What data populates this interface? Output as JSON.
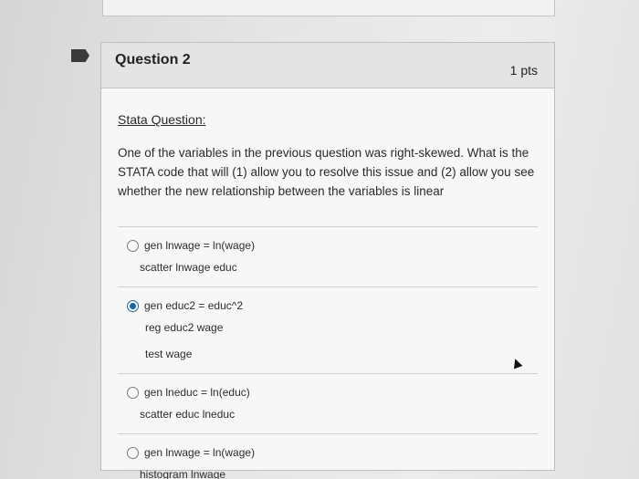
{
  "question": {
    "title": "Question 2",
    "points": "1 pts",
    "section_label": "Stata Question:",
    "prompt": "One of the variables in the previous question was right-skewed. What is the STATA code that will (1) allow you to resolve this issue and (2) allow you see whether the new relationship between the variables is linear"
  },
  "answers": [
    {
      "lines": [
        "gen lnwage = ln(wage)",
        "scatter lnwage educ"
      ],
      "selected": false
    },
    {
      "lines": [
        "gen educ2 = educ^2",
        "reg educ2 wage",
        "test wage"
      ],
      "selected": true
    },
    {
      "lines": [
        "gen lneduc = ln(educ)",
        "scatter educ lneduc"
      ],
      "selected": false
    },
    {
      "lines": [
        "gen lnwage = ln(wage)",
        "histogram lnwage"
      ],
      "selected": false
    }
  ],
  "colors": {
    "accent": "#1466a8",
    "header_bg": "#e4e4e4"
  },
  "icons": {
    "flag": "bookmark-icon",
    "pointer": "mouse-cursor-icon"
  }
}
